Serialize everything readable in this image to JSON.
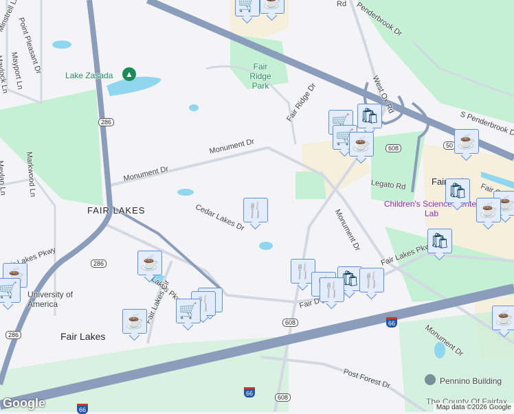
{
  "colors": {
    "highway": "#8a9ebc",
    "road": "#d3d9e2",
    "park": "#c4f0d4",
    "water": "#8fd7ee",
    "commercial": "#f6efdc",
    "marker_bg": "#e3ecfb",
    "marker_icon": "#063a5e"
  },
  "labels": {
    "minstrell": "Minstrell Ln",
    "point_pleasant": "Point Pleasant Dr",
    "maypork": "Mayport Ln",
    "maylock": "Maylock Ln",
    "markwood": "Markwood Ln",
    "meylan": "Meylan Ln",
    "lake_zasada": "Lake Zasada",
    "fair_ridge_park": "Fair Ridge Park",
    "fair_ridge_dr": "Fair Ridge Dr",
    "monument_dr_1": "Monument Dr",
    "monument_dr_2": "Monument Dr",
    "monument_dr_3": "Monument Dr",
    "monument_dr_4": "Monument Dr",
    "fair_lakes_area": "FAIR LAKES",
    "cedar_lakes": "Cedar Lakes Dr",
    "fair_lakes_pkwy_1": "Fair Lakes Pkwy",
    "fair_lakes_pkwy_2": "Fair Lakes Pkwy",
    "fair_lakes_pkwy_3": "Fair Lakes Pkwy",
    "fair_lakes_pkwy_4": "Fair Lakes Pkwy",
    "fair_lakes_cir": "Fair Lakes Cir",
    "fair_lakes_town": "Fair Lakes",
    "university": "University of America",
    "penderbrook": "Penderbrook Dr",
    "s_penderbrook": "S Penderbrook Dr",
    "west_ox": "West Ox Rd",
    "legato": "Legato Rd",
    "fair_oaks": "Fair Oaks",
    "fair_oak_rd": "Fair Oak",
    "childrens": "Children's Science Center Lab",
    "post_forest": "Post Forest Dr",
    "pennino": "Pennino Building",
    "county": "The County Of Fairfax",
    "fair_d": "Fair D",
    "rd": "Rd"
  },
  "shields": {
    "r286a": "286",
    "r286b": "286",
    "r286c": "286",
    "r608a": "608",
    "r608b": "608",
    "r608c": "608",
    "us50": "50",
    "i66a": "66",
    "i66b": "66",
    "i66c": "66"
  },
  "markers": {
    "cart": "🛒",
    "coffee": "☕",
    "bag": "🛍",
    "food": "🍴"
  },
  "footer": {
    "logo": "Google",
    "attribution": "Map data ©2026 Google"
  }
}
